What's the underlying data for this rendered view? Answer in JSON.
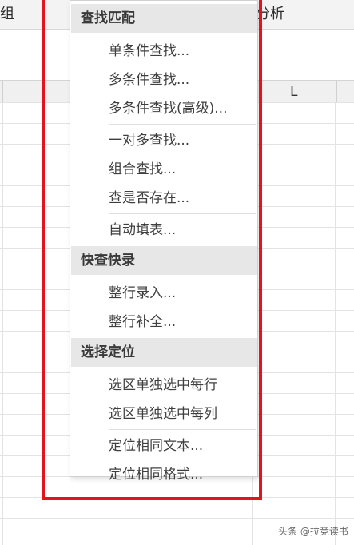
{
  "ribbon": {
    "left_fragment": "组",
    "right_fragment": "分析"
  },
  "column_header": {
    "visible_label": "L"
  },
  "menu": {
    "sections": [
      {
        "header": "查找匹配",
        "groups": [
          [
            "单条件查找...",
            "多条件查找...",
            "多条件查找(高级)..."
          ],
          [
            "一对多查找...",
            "组合查找...",
            "查是否存在..."
          ],
          [
            "自动填表..."
          ]
        ]
      },
      {
        "header": "快查快录",
        "groups": [
          [
            "整行录入...",
            "整行补全..."
          ]
        ]
      },
      {
        "header": "选择定位",
        "groups": [
          [
            "选区单独选中每行",
            "选区单独选中每列"
          ],
          [
            "定位相同文本...",
            "定位相同格式..."
          ]
        ]
      }
    ]
  },
  "watermark": "头条 @拉竞读书",
  "colors": {
    "highlight_border": "#e3141b",
    "menu_header_bg": "#e7e7e7"
  }
}
